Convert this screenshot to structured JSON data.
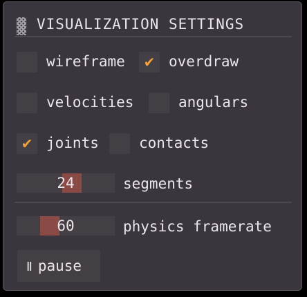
{
  "window": {
    "title": "VISUALIZATION SETTINGS",
    "grip_icon": "drag-handle-icon"
  },
  "checkboxes": {
    "wireframe": {
      "label": "wireframe",
      "checked": false
    },
    "overdraw": {
      "label": "overdraw",
      "checked": true
    },
    "velocities": {
      "label": "velocities",
      "checked": false
    },
    "angulars": {
      "label": "angulars",
      "checked": false
    },
    "joints": {
      "label": "joints",
      "checked": true
    },
    "contacts": {
      "label": "contacts",
      "checked": false
    },
    "check_glyph": "✔"
  },
  "sliders": {
    "segments": {
      "value": "24",
      "label": "segments"
    },
    "physics_framerate": {
      "value": "60",
      "label": "physics framerate"
    }
  },
  "pause_button": {
    "icon": "Ⅱ",
    "label": "pause"
  },
  "colors": {
    "panel_bg": "#3b363d",
    "widget_bg": "#443e45",
    "accent_check": "#f2a03c",
    "slider_grab": "#8a4a45",
    "text": "#ebe6ea"
  }
}
